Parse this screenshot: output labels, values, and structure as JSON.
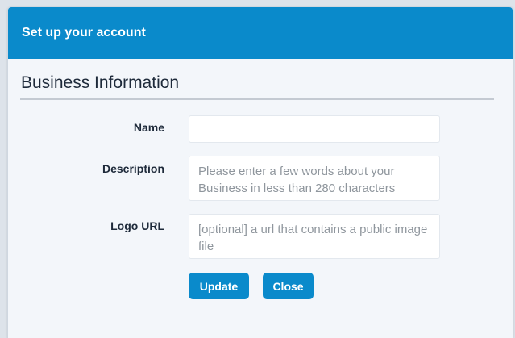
{
  "dialog": {
    "title": "Set up your account",
    "section_title": "Business Information"
  },
  "form": {
    "name": {
      "label": "Name",
      "value": "",
      "placeholder": ""
    },
    "description": {
      "label": "Description",
      "value": "",
      "placeholder": "Please enter a few words about your Business in less than 280 characters"
    },
    "logo_url": {
      "label": "Logo URL",
      "value": "",
      "placeholder": "[optional] a url that contains a public image file"
    }
  },
  "buttons": {
    "update_label": "Update",
    "close_label": "Close"
  },
  "colors": {
    "accent": "#0a8acb",
    "background": "#f3f6fa"
  }
}
